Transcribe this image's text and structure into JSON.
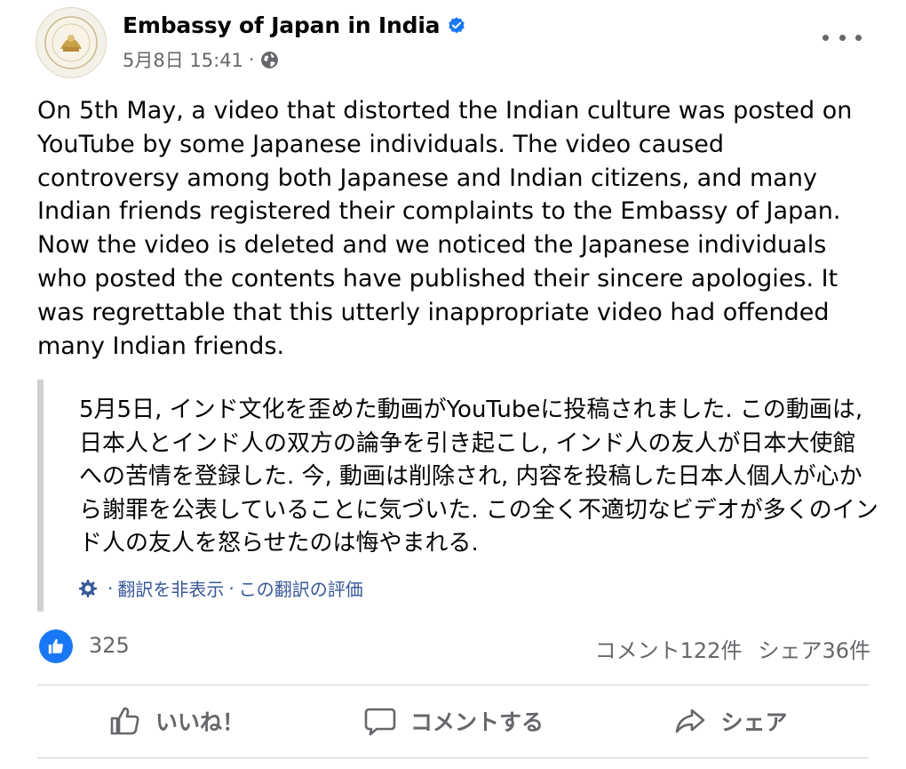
{
  "post": {
    "author": "Embassy of Japan in India",
    "timestamp": "5月8日 15:41",
    "separator": "·",
    "body": "On 5th May, a video that distorted the Indian culture was posted on YouTube by some Japanese individuals. The video caused controversy among both Japanese and Indian citizens, and many Indian friends registered their complaints to the Embassy of Japan. Now the video is deleted and we noticed the Japanese individuals who posted the contents have published their sincere apologies. It was regrettable that this utterly inappropriate video had offended many Indian friends."
  },
  "translation": {
    "text": "5月5日, インド文化を歪めた動画がYouTubeに投稿されました. この動画は, 日本人とインド人の双方の論争を引き起こし, インド人の友人が日本大使館への苦情を登録した. 今, 動画は削除され, 内容を投稿した日本人個人が心から謝罪を公表していることに気づいた. この全く不適切なビデオが多くのインド人の友人を怒らせたのは悔やまれる.",
    "separator": "·",
    "hide_label": "翻訳を非表示",
    "rate_label": "この翻訳の評価"
  },
  "stats": {
    "like_count": "325",
    "comments": "コメント122件",
    "shares": "シェア36件"
  },
  "actions": {
    "like": "いいね！",
    "comment": "コメントする",
    "share": "シェア"
  },
  "icons": {
    "verified": "verified-badge-icon",
    "globe": "globe-icon",
    "more": "more-options-icon",
    "gear": "gear-icon",
    "like_badge": "thumbs-up-icon",
    "like_action": "thumbs-up-outline-icon",
    "comment_action": "speech-bubble-icon",
    "share_action": "share-arrow-icon"
  },
  "colors": {
    "accent": "#1877f2",
    "link": "#385898",
    "secondary_text": "#65676b",
    "divider": "#ced0d4"
  }
}
